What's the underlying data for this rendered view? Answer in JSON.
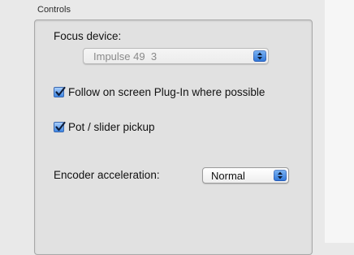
{
  "group": {
    "title": "Controls"
  },
  "focus_device": {
    "label": "Focus device:",
    "value": "Impulse 49  3",
    "disabled": true
  },
  "checkboxes": [
    {
      "label": "Follow on screen Plug-In where possible",
      "checked": true
    },
    {
      "label": "Pot / slider pickup",
      "checked": true
    }
  ],
  "encoder_acceleration": {
    "label": "Encoder acceleration:",
    "value": "Normal"
  },
  "colors": {
    "accent": "#3a82e6",
    "panel": "#e1e1e1",
    "disabled_text": "#8a8a8a"
  }
}
